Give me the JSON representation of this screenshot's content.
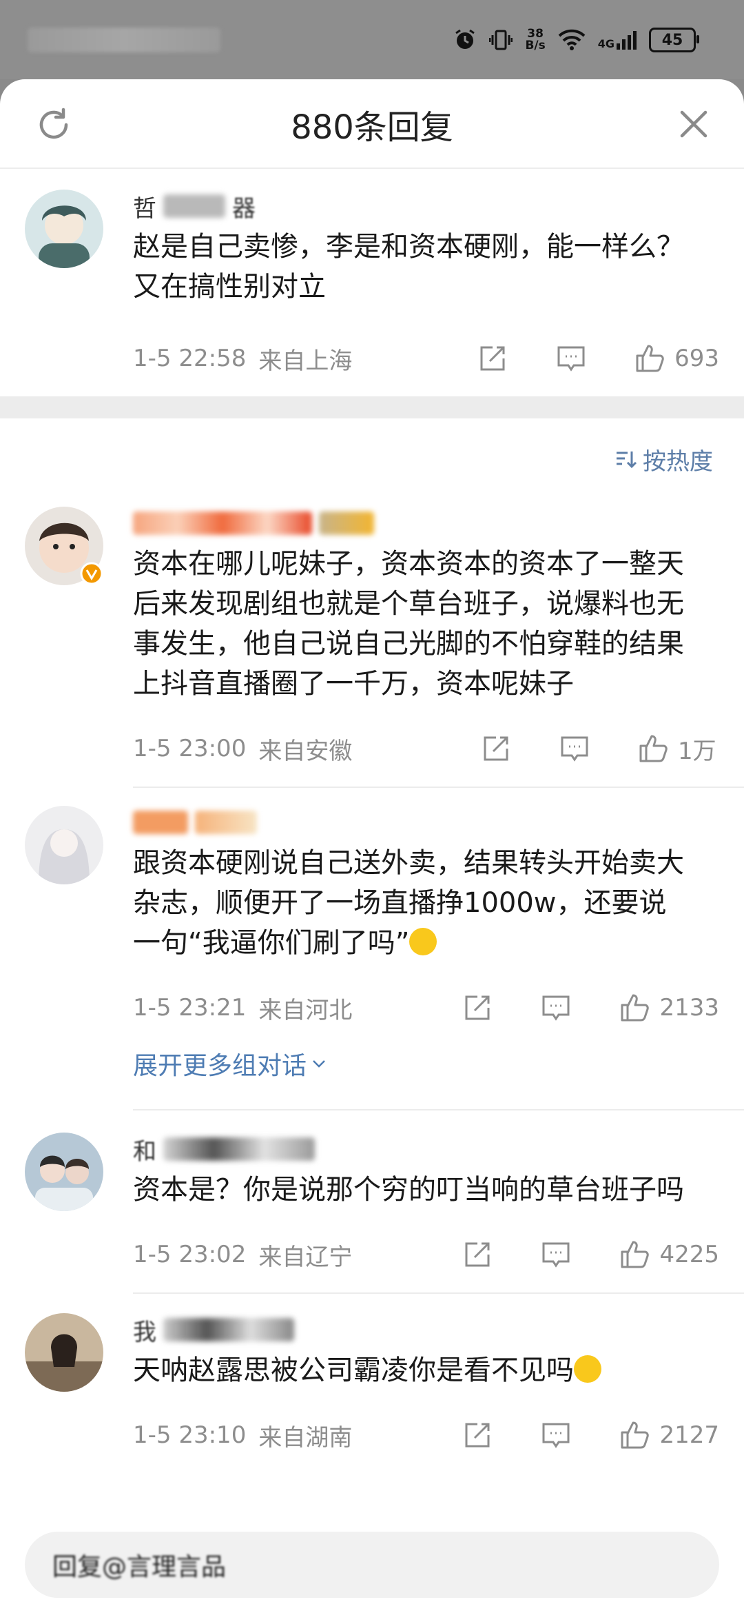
{
  "status_bar": {
    "net_speed": "38\nB/s",
    "net_speed_value": "38",
    "net_speed_unit": "B/s",
    "network_type": "4G",
    "battery": "45"
  },
  "sheet": {
    "title": "880条回复"
  },
  "top_comment": {
    "username": "哲",
    "username_tail": "器",
    "text": "赵是自己卖惨，李是和资本硬刚，能一样么？又在搞性别对立",
    "timestamp": "1-5 22:58",
    "location": "来自上海",
    "like_count": "693"
  },
  "sort": {
    "label": "按热度"
  },
  "comments": [
    {
      "text": "资本在哪儿呢妹子，资本资本的资本了一整天后来发现剧组也就是个草台班子，说爆料也无事发生，他自己说自己光脚的不怕穿鞋的结果上抖音直播圈了一千万，资本呢妹子",
      "timestamp": "1-5 23:00",
      "location": "来自安徽",
      "like_count": "1万"
    },
    {
      "text": "跟资本硬刚说自己送外卖，结果转头开始卖大杂志，顺便开了一场直播挣1000w，还要说一句“我逼你们刷了吗”",
      "timestamp": "1-5 23:21",
      "location": "来自河北",
      "like_count": "2133",
      "expand_label": "展开更多组对话"
    },
    {
      "username": "和",
      "text": "资本是？你是说那个穷的叮当响的草台班子吗",
      "timestamp": "1-5 23:02",
      "location": "来自辽宁",
      "like_count": "4225"
    },
    {
      "username": "我",
      "text": "天呐赵露思被公司霸凌你是看不见吗",
      "timestamp": "1-5 23:10",
      "location": "来自湖南",
      "like_count": "2127"
    }
  ],
  "reply_bar": {
    "placeholder": "回复@言理言品"
  },
  "colors": {
    "link": "#4e7cb3",
    "meta": "#8d8d8d",
    "sort": "#5d7ea8",
    "badge": "#f39800"
  },
  "icons": [
    "refresh-icon",
    "close-icon",
    "share-icon",
    "comment-icon",
    "like-icon",
    "sort-icon",
    "chevron-down-icon",
    "grin-emoji-icon",
    "smirk-emoji-icon",
    "verified-badge-icon"
  ]
}
